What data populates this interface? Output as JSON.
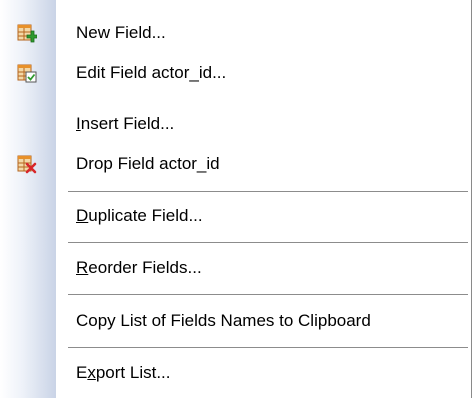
{
  "menu": {
    "items": [
      {
        "label": "New Field...",
        "icon": "new-field-icon"
      },
      {
        "label": "Edit Field actor_id...",
        "icon": "edit-field-icon"
      },
      {
        "label": "Insert Field...",
        "mnemonic": "I"
      },
      {
        "label": "Drop Field actor_id",
        "icon": "drop-field-icon"
      },
      {
        "label": "Duplicate Field...",
        "mnemonic": "D"
      },
      {
        "label": "Reorder Fields...",
        "mnemonic": "R"
      },
      {
        "label": "Copy List of Fields Names to Clipboard"
      },
      {
        "label": "Export List...",
        "mnemonic": "x"
      }
    ]
  },
  "colors": {
    "icon_orange": "#e8912a",
    "icon_green": "#2f9a2f",
    "icon_red": "#d8262a",
    "separator": "#8c8c8c",
    "gutter": "#c9d3e6"
  }
}
